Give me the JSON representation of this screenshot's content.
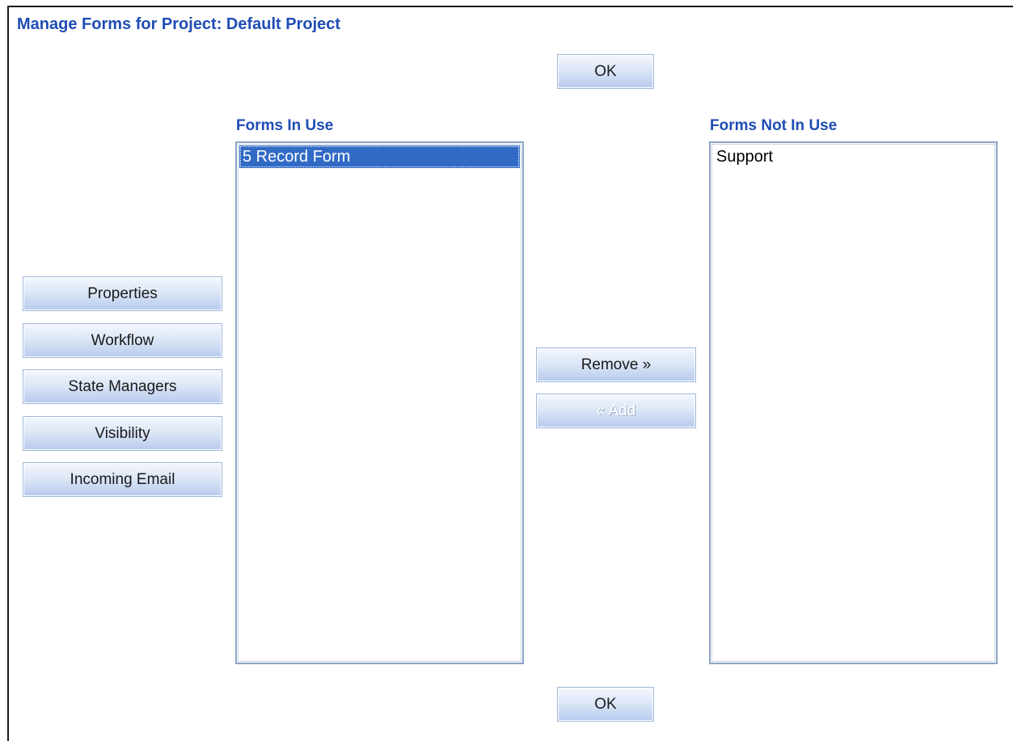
{
  "page": {
    "title": "Manage Forms for Project: Default Project"
  },
  "buttons": {
    "ok_top": "OK",
    "ok_bottom": "OK",
    "remove": "Remove »",
    "add": "« Add"
  },
  "side_buttons": [
    {
      "label": "Properties"
    },
    {
      "label": "Workflow"
    },
    {
      "label": "State Managers"
    },
    {
      "label": "Visibility"
    },
    {
      "label": "Incoming Email"
    }
  ],
  "forms_in_use": {
    "label": "Forms In Use",
    "items": [
      {
        "text": "5  Record Form",
        "selected": true
      }
    ]
  },
  "forms_not_in_use": {
    "label": "Forms Not In Use",
    "items": [
      {
        "text": "Support",
        "selected": false
      }
    ]
  },
  "colors": {
    "title": "#1f4db4",
    "selection": "#316ac5"
  }
}
